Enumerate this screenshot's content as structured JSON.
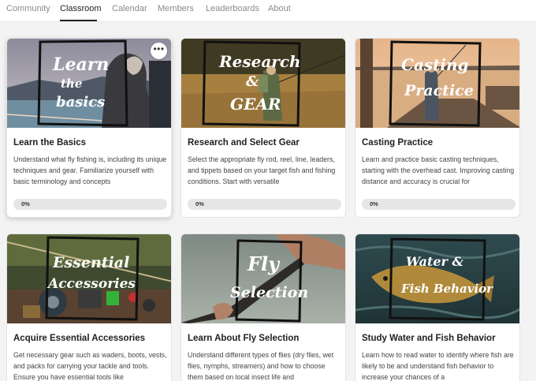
{
  "nav": {
    "tabs": [
      {
        "label": "Community"
      },
      {
        "label": "Classroom",
        "active": true
      },
      {
        "label": "Calendar"
      },
      {
        "label": "Members"
      },
      {
        "label": "Leaderboards"
      },
      {
        "label": "About"
      }
    ]
  },
  "courses": [
    {
      "thumb_lines": [
        "Learn",
        "the",
        "basics"
      ],
      "title": "Learn the Basics",
      "description": "Understand what fly fishing is, including its unique techniques and gear. Familiarize yourself with basic terminology and concepts",
      "progress": "0%",
      "progress_value": 0,
      "more_icon": "more-horizontal-icon"
    },
    {
      "thumb_lines": [
        "Research",
        "&",
        "GEAR"
      ],
      "title": "Research and Select Gear",
      "description": "Select the appropriate fly rod, reel, line, leaders, and tippets based on your target fish and fishing conditions. Start with versatile",
      "progress": "0%",
      "progress_value": 0
    },
    {
      "thumb_lines": [
        "Casting",
        "Practice"
      ],
      "title": "Casting Practice",
      "description": "Learn and practice basic casting techniques, starting with the overhead cast. Improving casting distance and accuracy is crucial for",
      "progress": "0%",
      "progress_value": 0
    },
    {
      "thumb_lines": [
        "Essential",
        "Accessories"
      ],
      "title": "Acquire Essential Accessories",
      "description": "Get necessary gear such as waders, boots, vests, and packs for carrying your tackle and tools. Ensure you have essential tools like"
    },
    {
      "thumb_lines": [
        "Fly",
        "Selection"
      ],
      "title": "Learn About Fly Selection",
      "description": "Understand different types of flies (dry flies, wet flies, nymphs, streamers) and how to choose them based on local insect life and"
    },
    {
      "thumb_lines": [
        "Water &",
        "Fish Behavior"
      ],
      "title": "Study Water and Fish Behavior",
      "description": "Learn how to read water to identify where fish are likely to be and understand fish behavior to increase your chances of a"
    }
  ],
  "colors": {
    "active_tab": "#202124",
    "inactive_tab": "#8a8a8a",
    "progress_track": "#e6e6e6"
  }
}
